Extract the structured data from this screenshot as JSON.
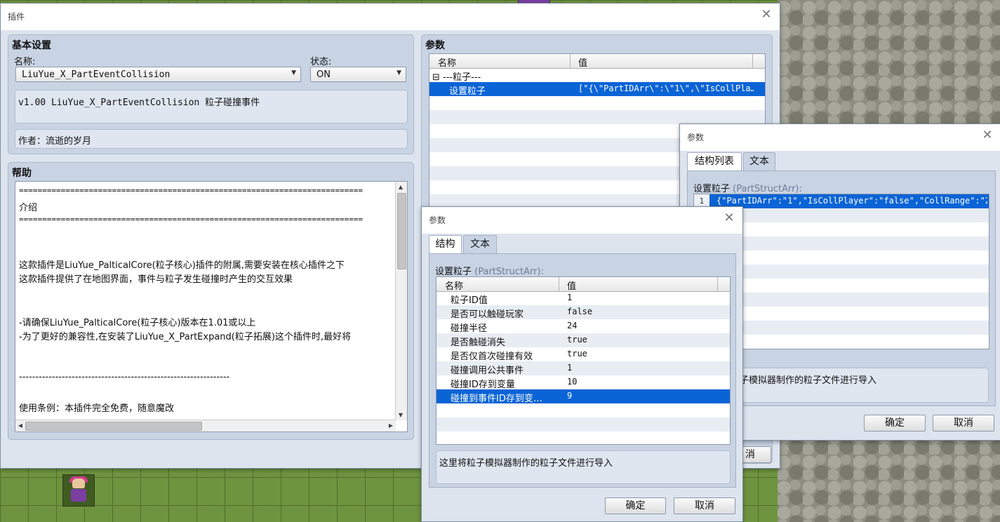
{
  "main_window": {
    "title": "插件",
    "close": "✕",
    "basic_settings": {
      "title": "基本设置",
      "name_label": "名称:",
      "name_value": "LiuYue_X_PartEventCollision",
      "status_label": "状态:",
      "status_value": "ON",
      "description": "v1.00 LiuYue_X_PartEventCollision 粒子碰撞事件",
      "author": "作者：流逝的岁月"
    },
    "help": {
      "title": "帮助",
      "lines": [
        "==========================================================================",
        "介绍",
        "==========================================================================",
        "",
        "",
        "这款插件是LiuYue_PalticalCore(粒子核心)插件的附属,需要安装在核心插件之下",
        "这款插件提供了在地图界面，事件与粒子发生碰撞时产生的交互效果",
        "",
        "",
        "-请确保LiuYue_PalticalCore(粒子核心)版本在1.01或以上",
        "-为了更好的兼容性,在安装了LiuYue_X_PartExpand(粒子拓展)这个插件时,最好将",
        "",
        "",
        "----------------------------------------------------------------",
        "",
        "使用条例：本插件完全免费，随意魔改"
      ]
    },
    "params": {
      "title": "参数",
      "col_name": "名称",
      "col_value": "值",
      "rows": [
        {
          "name": "⊟ ---粒子---",
          "value": ""
        },
        {
          "name": "设置粒子",
          "value": "[\"{\\\"PartIDArr\\\":\\\"1\\\",\\\"IsCollPla…"
        }
      ],
      "partial_button": "消"
    }
  },
  "struct_list_window": {
    "title": "参数",
    "close": "✕",
    "tabs": [
      "结构列表",
      "文本"
    ],
    "field_label": "设置粒子",
    "field_type": "(PartStructArr):",
    "items": [
      {
        "index": "1",
        "value": "{\"PartIDArr\":\"1\",\"IsCollPlayer\":\"false\",\"CollRange\":\"2…"
      }
    ],
    "help_text": "子模拟器制作的粒子文件进行导入",
    "ok": "确定",
    "cancel": "取消"
  },
  "struct_window": {
    "title": "参数",
    "close": "✕",
    "tabs": [
      "结构",
      "文本"
    ],
    "field_label": "设置粒子",
    "field_type": "(PartStructArr):",
    "col_name": "名称",
    "col_value": "值",
    "rows": [
      {
        "name": "粒子ID值",
        "value": "1"
      },
      {
        "name": "是否可以触碰玩家",
        "value": "false"
      },
      {
        "name": "碰撞半径",
        "value": "24"
      },
      {
        "name": "是否触碰消失",
        "value": "true"
      },
      {
        "name": "是否仅首次碰撞有效",
        "value": "true"
      },
      {
        "name": "碰撞调用公共事件",
        "value": "1"
      },
      {
        "name": "碰撞ID存到变量",
        "value": "10"
      },
      {
        "name": "碰撞到事件ID存到变…",
        "value": "9"
      }
    ],
    "help_text": "这里将粒子模拟器制作的粒子文件进行导入",
    "ok": "确定",
    "cancel": "取消"
  }
}
